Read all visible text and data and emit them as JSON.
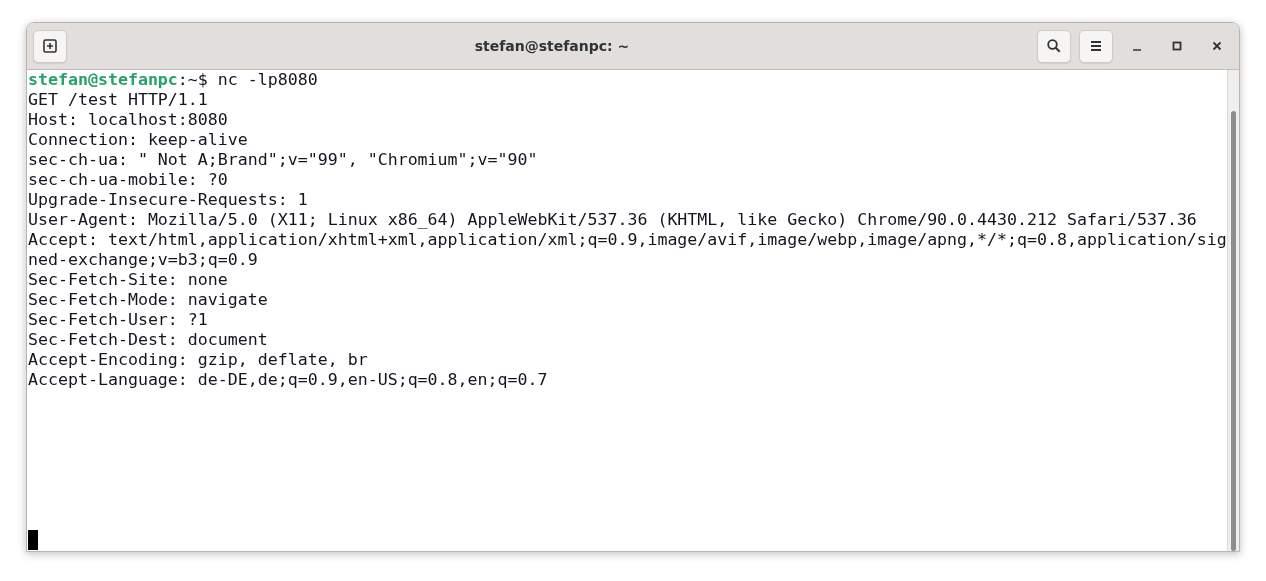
{
  "window": {
    "title": "stefan@stefanpc: ~"
  },
  "terminal": {
    "lines": [
      {
        "kind": "prompt",
        "user": "stefan@stefanpc",
        "text": ":~$ nc -lp8080"
      },
      {
        "kind": "output",
        "text": "GET /test HTTP/1.1"
      },
      {
        "kind": "output",
        "text": "Host: localhost:8080"
      },
      {
        "kind": "output",
        "text": "Connection: keep-alive"
      },
      {
        "kind": "output",
        "text": "sec-ch-ua: \" Not A;Brand\";v=\"99\", \"Chromium\";v=\"90\""
      },
      {
        "kind": "output",
        "text": "sec-ch-ua-mobile: ?0"
      },
      {
        "kind": "output",
        "text": "Upgrade-Insecure-Requests: 1"
      },
      {
        "kind": "output",
        "text": "User-Agent: Mozilla/5.0 (X11; Linux x86_64) AppleWebKit/537.36 (KHTML, like Gecko) Chrome/90.0.4430.212 Safari/537.36"
      },
      {
        "kind": "output",
        "text": "Accept: text/html,application/xhtml+xml,application/xml;q=0.9,image/avif,image/webp,image/apng,*/*;q=0.8,application/sig"
      },
      {
        "kind": "output",
        "text": "ned-exchange;v=b3;q=0.9"
      },
      {
        "kind": "output",
        "text": "Sec-Fetch-Site: none"
      },
      {
        "kind": "output",
        "text": "Sec-Fetch-Mode: navigate"
      },
      {
        "kind": "output",
        "text": "Sec-Fetch-User: ?1"
      },
      {
        "kind": "output",
        "text": "Sec-Fetch-Dest: document"
      },
      {
        "kind": "output",
        "text": "Accept-Encoding: gzip, deflate, br"
      },
      {
        "kind": "output",
        "text": "Accept-Language: de-DE,de;q=0.9,en-US;q=0.8,en;q=0.7"
      }
    ]
  }
}
